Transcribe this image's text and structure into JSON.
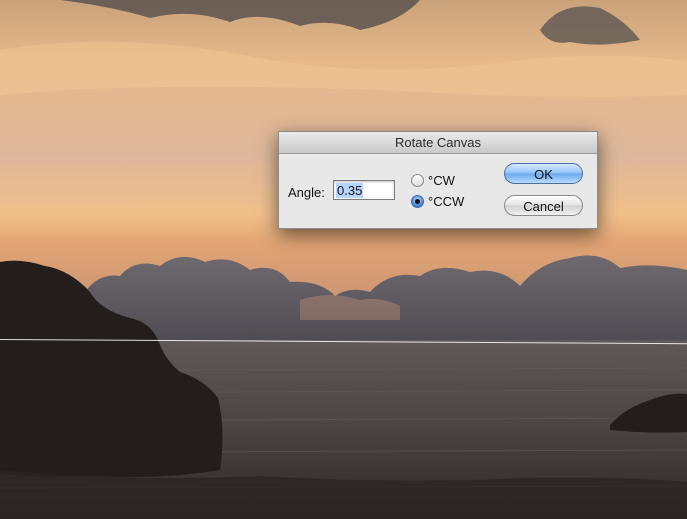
{
  "dialog": {
    "title": "Rotate Canvas",
    "angle_label": "Angle:",
    "angle_value": "0.35",
    "options": {
      "cw_label": "°CW",
      "ccw_label": "°CCW",
      "selected": "ccw"
    },
    "ok_label": "OK",
    "cancel_label": "Cancel"
  },
  "colors": {
    "ok_button_accent": "#6aa7ee",
    "selection_highlight": "#b5d5ff"
  }
}
